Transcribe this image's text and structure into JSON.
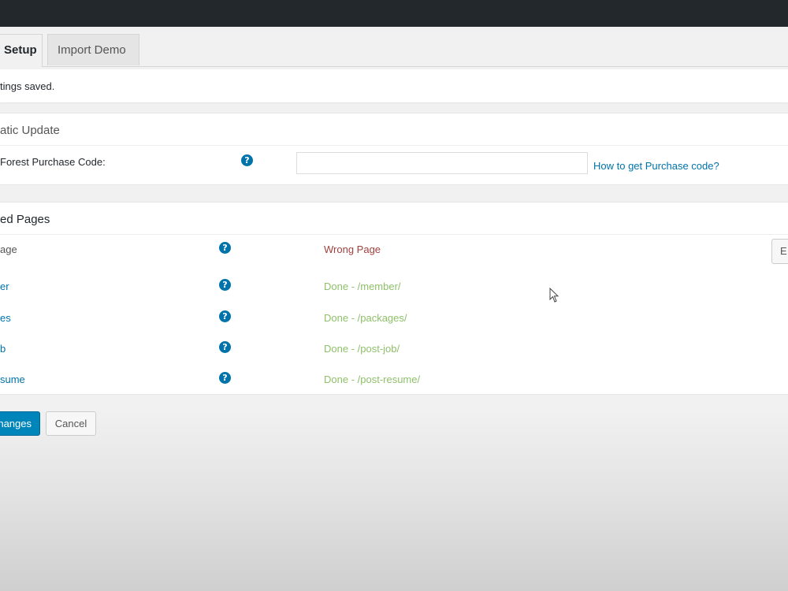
{
  "tabs": [
    {
      "label": "Setup"
    },
    {
      "label": "Import Demo"
    }
  ],
  "notice": {
    "text": "tings saved."
  },
  "auto_update": {
    "title": "atic Update",
    "purchase_label": "Forest Purchase Code:",
    "help_glyph": "?",
    "purchase_value": "",
    "purchase_link": "How to get Purchase code?"
  },
  "pages": {
    "title": "ed Pages",
    "rows": [
      {
        "label": "age",
        "status": "Wrong Page"
      },
      {
        "label": "er",
        "status": "Done - /member/"
      },
      {
        "label": "es",
        "status": "Done - /packages/"
      },
      {
        "label": "b",
        "status": "Done - /post-job/"
      },
      {
        "label": "sume",
        "status": "Done - /post-resume/"
      }
    ],
    "edit_label": "E"
  },
  "actions": {
    "save_label": "hanges",
    "cancel_label": "Cancel"
  },
  "colors": {
    "admin_bar": "#23282d",
    "primary": "#0073aa",
    "wrong": "#a0413d",
    "done": "#8fc06a"
  }
}
